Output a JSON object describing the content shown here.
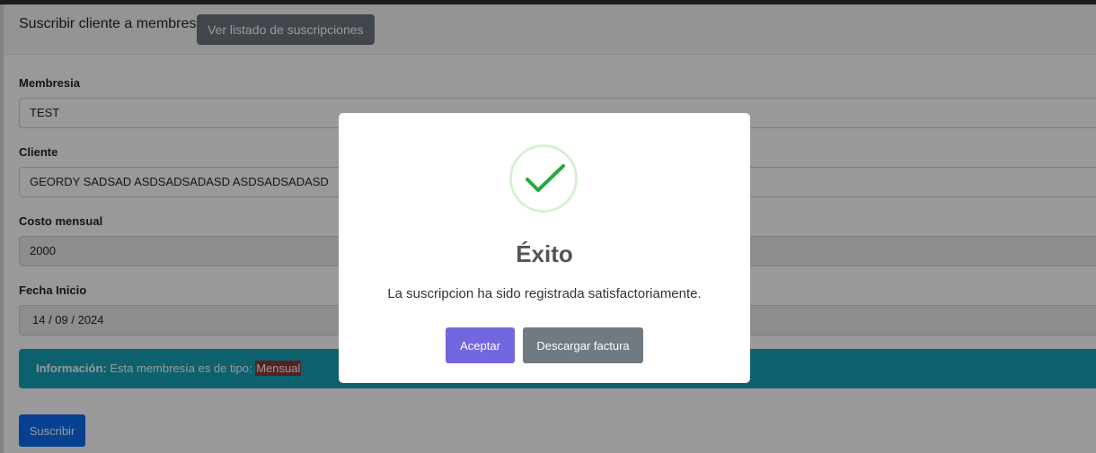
{
  "header": {
    "title": "Suscribir cliente a membresía",
    "list_button": "Ver listado de suscripciones"
  },
  "form": {
    "membership": {
      "label": "Membresia",
      "value": "TEST"
    },
    "client": {
      "label": "Cliente",
      "value": "GEORDY SADSAD ASDSADSADASD ASDSADSADASD"
    },
    "monthly_cost": {
      "label": "Costo mensual",
      "value": "2000"
    },
    "start_date": {
      "label": "Fecha Inicio",
      "value": "14 / 09 / 2024"
    }
  },
  "info_alert": {
    "prefix": "Información:",
    "text": "Esta membresía es de tipo:",
    "type": "Mensual"
  },
  "subscribe_button": "Suscribir",
  "modal": {
    "icon": "check-icon",
    "title": "Éxito",
    "message": "La suscripcion ha sido registrada satisfactoriamente.",
    "accept_button": "Aceptar",
    "invoice_button": "Descargar factura"
  },
  "colors": {
    "info": "#17a2b8",
    "primary": "#0b6cf2",
    "secondary": "#6c757d",
    "accept": "#7367e0",
    "success_check": "#28a745"
  }
}
